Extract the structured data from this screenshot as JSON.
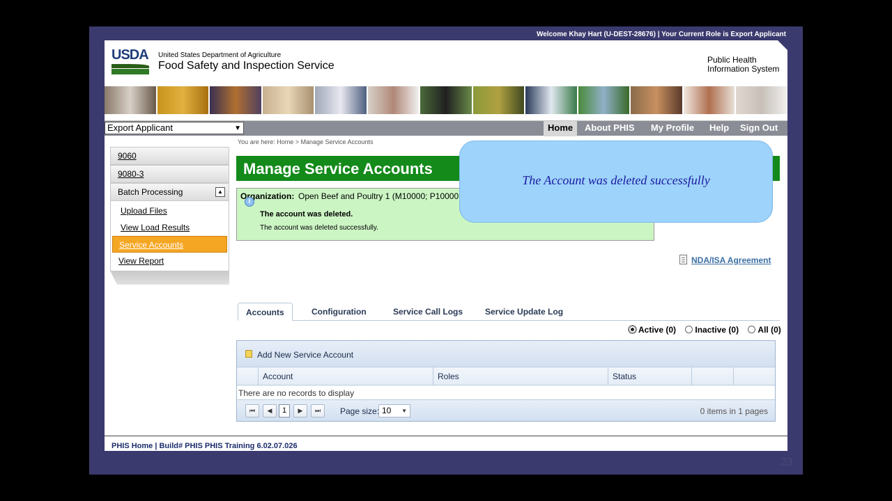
{
  "welcome": "Welcome Khay Hart (U-DEST-28676)  |  Your Current Role is Export Applicant",
  "header": {
    "logo": "USDA",
    "department": "United States Department of Agriculture",
    "agency": "Food Safety and Inspection Service",
    "system": "Public Health Information System"
  },
  "role_select": {
    "value": "Export Applicant"
  },
  "topnav": [
    "Home",
    "About PHIS",
    "My Profile",
    "Help",
    "Sign Out"
  ],
  "sidebar": {
    "items": [
      "9060",
      "9080-3",
      "Batch Processing"
    ],
    "sub_items": [
      "Upload Files",
      "View Load Results",
      "Service Accounts",
      "View Report"
    ]
  },
  "breadcrumb": "You are here:  Home > Manage Service Accounts",
  "page_title": "Manage Service Accounts",
  "message": {
    "org_label": "Organization:",
    "org_value": "Open Beef and Poultry 1 (M10000; P10000",
    "heading": "The account was deleted.",
    "body": "The account was deleted successfully."
  },
  "callout": "The Account was deleted successfully",
  "nda_link": "NDA/ISA Agreement",
  "tabs": [
    "Accounts",
    "Configuration",
    "Service Call Logs",
    "Service Update Log"
  ],
  "filters": [
    "Active (0)",
    "Inactive (0)",
    "All (0)"
  ],
  "grid": {
    "add_label": "Add New Service Account",
    "columns": [
      "Account",
      "Roles",
      "Status"
    ],
    "empty": "There are no records to display",
    "page_current": "1",
    "page_size_label": "Page size:",
    "page_size": "10",
    "items_text": "0 items in 1 pages"
  },
  "footer": "PHIS Home | Build# PHIS PHIS Training 6.02.07.026",
  "slide_number": "23",
  "colors": {
    "title_green": "#138a1a",
    "selected_orange": "#f5a623",
    "callout_blue": "#9ed3fb"
  }
}
